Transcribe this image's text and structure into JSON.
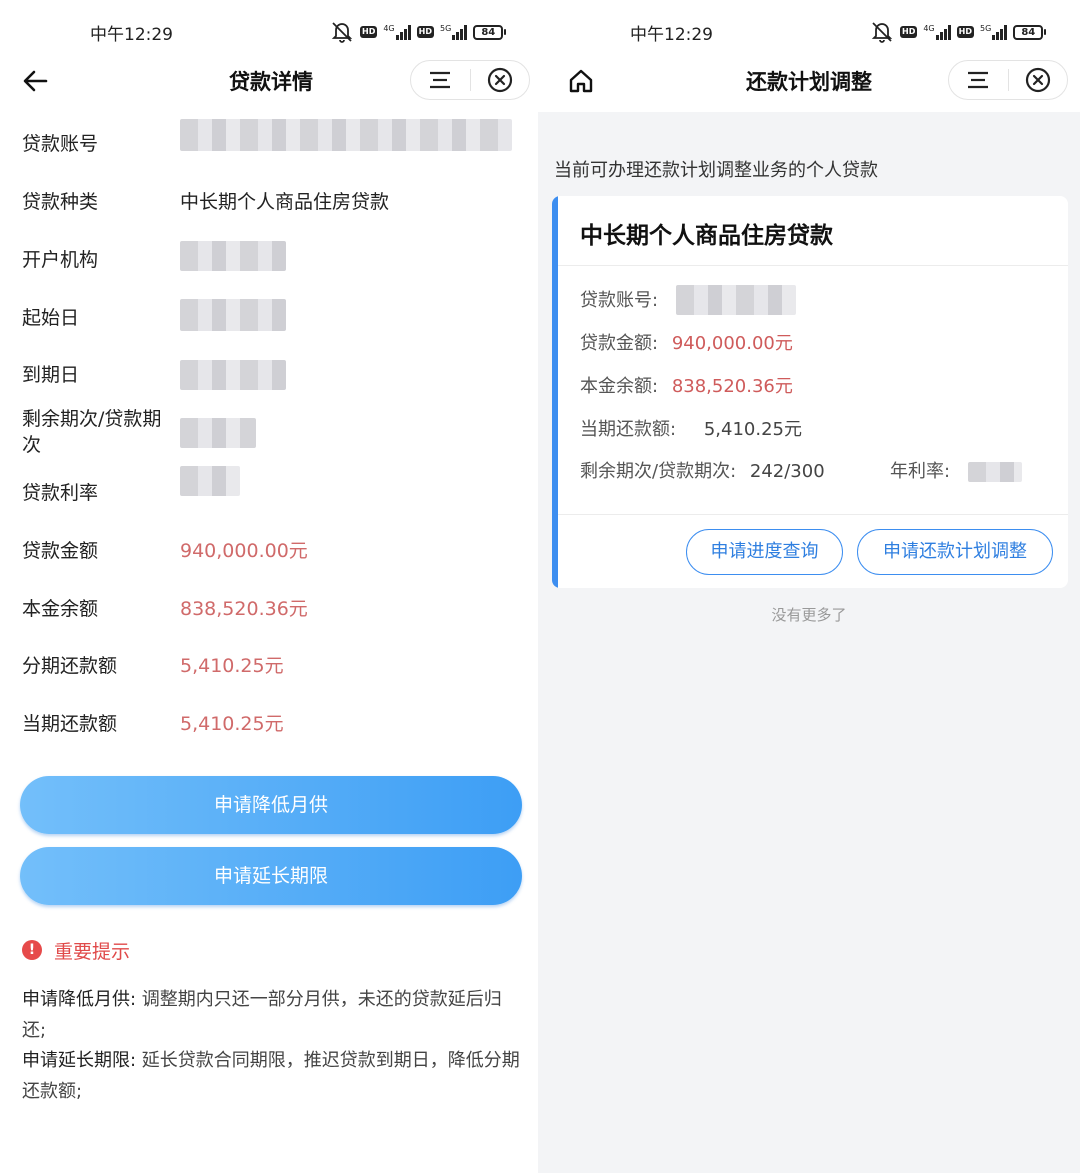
{
  "left": {
    "status_bar": {
      "time": "中午12:29",
      "net1": "4G",
      "net2": "5G",
      "battery": "84"
    },
    "header": {
      "title": "贷款详情"
    },
    "details": [
      {
        "label": "贷款账号",
        "value": ""
      },
      {
        "label": "贷款种类",
        "value": "中长期个人商品住房贷款"
      },
      {
        "label": "开户机构",
        "value": ""
      },
      {
        "label": "起始日",
        "value": ""
      },
      {
        "label": "到期日",
        "value": ""
      },
      {
        "label": "剩余期次/贷款期次",
        "value": ""
      },
      {
        "label": "贷款利率",
        "value": ""
      },
      {
        "label": "贷款金额",
        "value": "940,000.00元"
      },
      {
        "label": "本金余额",
        "value": "838,520.36元"
      },
      {
        "label": "分期还款额",
        "value": "5,410.25元"
      },
      {
        "label": "当期还款额",
        "value": "5,410.25元"
      }
    ],
    "buttons": {
      "reduce_payment": "申请降低月供",
      "extend_term": "申请延长期限"
    },
    "notice": {
      "icon_text": "!",
      "title": "重要提示",
      "p1_label": "申请降低月供:",
      "p1_text": " 调整期内只还一部分月供，未还的贷款延后归还;",
      "p2_label": "申请延长期限:",
      "p2_text": " 延长贷款合同期限，推迟贷款到期日，降低分期还款额;"
    }
  },
  "right": {
    "status_bar": {
      "time": "中午12:29",
      "net1": "4G",
      "net2": "5G",
      "battery": "84"
    },
    "header": {
      "title": "还款计划调整"
    },
    "subtitle": "当前可办理还款计划调整业务的个人贷款",
    "card": {
      "title": "中长期个人商品住房贷款",
      "account_label": "贷款账号:",
      "amount_label": "贷款金额:",
      "amount_value": "940,000.00元",
      "principal_label": "本金余额:",
      "principal_value": "838,520.36元",
      "current_label": "当期还款额:",
      "current_value": "5,410.25元",
      "term_label": "剩余期次/贷款期次:",
      "term_value": "242/300",
      "rate_label": "年利率:",
      "btn_progress": "申请进度查询",
      "btn_adjust": "申请还款计划调整"
    },
    "no_more": "没有更多了"
  },
  "icons": {
    "back": "arrow-left-icon",
    "home": "home-icon",
    "menu": "menu-icon",
    "close": "close-circle-icon",
    "mute": "bell-off-icon"
  },
  "colors": {
    "accent": "#3d8ef0",
    "money_red": "#d06a6a",
    "notice_red": "#e04a4a",
    "button_gradient_start": "#73bffa",
    "button_gradient_end": "#3d9ef5"
  }
}
